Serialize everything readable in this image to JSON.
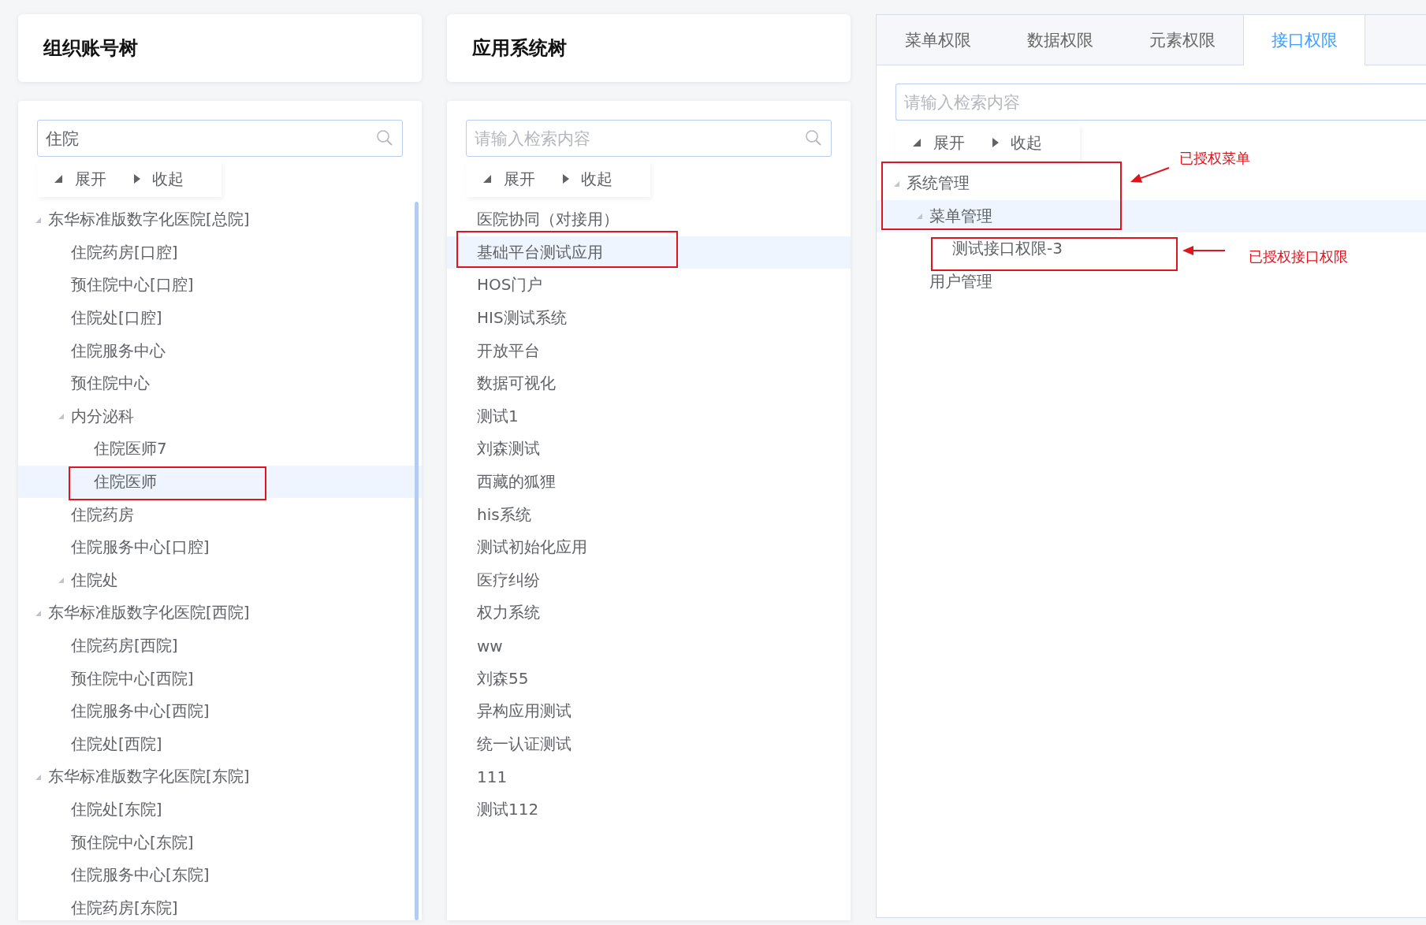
{
  "org_panel": {
    "title": "组织账号树",
    "search": {
      "value": "住院"
    },
    "toolbar": [
      {
        "kind": "expand",
        "label": "展开"
      },
      {
        "kind": "collapse",
        "label": "收起"
      }
    ],
    "tree": [
      {
        "label": "东华标准版数字化医院[总院]",
        "selected": false,
        "expanded": true,
        "children": [
          {
            "label": "住院药房[口腔]",
            "selected": false
          },
          {
            "label": "预住院中心[口腔]",
            "selected": false
          },
          {
            "label": "住院处[口腔]",
            "selected": false
          },
          {
            "label": "住院服务中心",
            "selected": false
          },
          {
            "label": "预住院中心",
            "selected": false
          },
          {
            "label": "内分泌科",
            "selected": false,
            "expanded": true,
            "children": [
              {
                "label": "住院医师7",
                "selected": false
              },
              {
                "label": "住院医师",
                "selected": true
              }
            ]
          },
          {
            "label": "住院药房",
            "selected": false
          },
          {
            "label": "住院服务中心[口腔]",
            "selected": false
          },
          {
            "label": "住院处",
            "selected": false,
            "expanded": true
          }
        ]
      },
      {
        "label": "东华标准版数字化医院[西院]",
        "selected": false,
        "expanded": true,
        "children": [
          {
            "label": "住院药房[西院]",
            "selected": false
          },
          {
            "label": "预住院中心[西院]",
            "selected": false
          },
          {
            "label": "住院服务中心[西院]",
            "selected": false
          },
          {
            "label": "住院处[西院]",
            "selected": false
          }
        ]
      },
      {
        "label": "东华标准版数字化医院[东院]",
        "selected": false,
        "expanded": true,
        "children": [
          {
            "label": "住院处[东院]",
            "selected": false
          },
          {
            "label": "预住院中心[东院]",
            "selected": false
          },
          {
            "label": "住院服务中心[东院]",
            "selected": false
          },
          {
            "label": "住院药房[东院]",
            "selected": false
          }
        ]
      }
    ]
  },
  "app_panel": {
    "title": "应用系统树",
    "search": {
      "placeholder": "请输入检索内容"
    },
    "toolbar": [
      {
        "kind": "expand",
        "label": "展开"
      },
      {
        "kind": "collapse",
        "label": "收起"
      }
    ],
    "tree": [
      {
        "label": "医院协同（对接用）",
        "selected": false
      },
      {
        "label": "基础平台测试应用",
        "selected": true
      },
      {
        "label": "HOS门户",
        "selected": false
      },
      {
        "label": "HIS测试系统",
        "selected": false
      },
      {
        "label": "开放平台",
        "selected": false
      },
      {
        "label": "数据可视化",
        "selected": false
      },
      {
        "label": "测试1",
        "selected": false
      },
      {
        "label": "刘森测试",
        "selected": false
      },
      {
        "label": "西藏的狐狸",
        "selected": false
      },
      {
        "label": "his系统",
        "selected": false
      },
      {
        "label": "测试初始化应用",
        "selected": false
      },
      {
        "label": "医疗纠纷",
        "selected": false
      },
      {
        "label": "权力系统",
        "selected": false
      },
      {
        "label": "ww",
        "selected": false
      },
      {
        "label": "刘森55",
        "selected": false
      },
      {
        "label": "异构应用测试",
        "selected": false
      },
      {
        "label": "统一认证测试",
        "selected": false
      },
      {
        "label": "111",
        "selected": false
      },
      {
        "label": "测试112",
        "selected": false
      }
    ]
  },
  "permission_panel": {
    "tabs": [
      {
        "label": "菜单权限",
        "selected": false
      },
      {
        "label": "数据权限",
        "selected": false
      },
      {
        "label": "元素权限",
        "selected": false
      },
      {
        "label": "接口权限",
        "selected": true
      }
    ],
    "search": {
      "placeholder": "请输入检索内容"
    },
    "toolbar": [
      {
        "kind": "expand",
        "label": "展开"
      },
      {
        "kind": "collapse",
        "label": "收起"
      }
    ],
    "tree": [
      {
        "label": "系统管理",
        "selected": false,
        "expanded": true,
        "children": [
          {
            "label": "菜单管理",
            "selected": true,
            "expanded": true,
            "children": [
              {
                "label": "测试接口权限-3",
                "selected": false
              }
            ]
          },
          {
            "label": "用户管理",
            "selected": false
          }
        ]
      }
    ]
  },
  "annotations": [
    {
      "kind": "box"
    },
    {
      "kind": "box"
    },
    {
      "kind": "box"
    },
    {
      "kind": "box"
    },
    {
      "kind": "callout",
      "text": "已授权菜单"
    },
    {
      "kind": "callout",
      "text": "已授权接口权限"
    }
  ]
}
